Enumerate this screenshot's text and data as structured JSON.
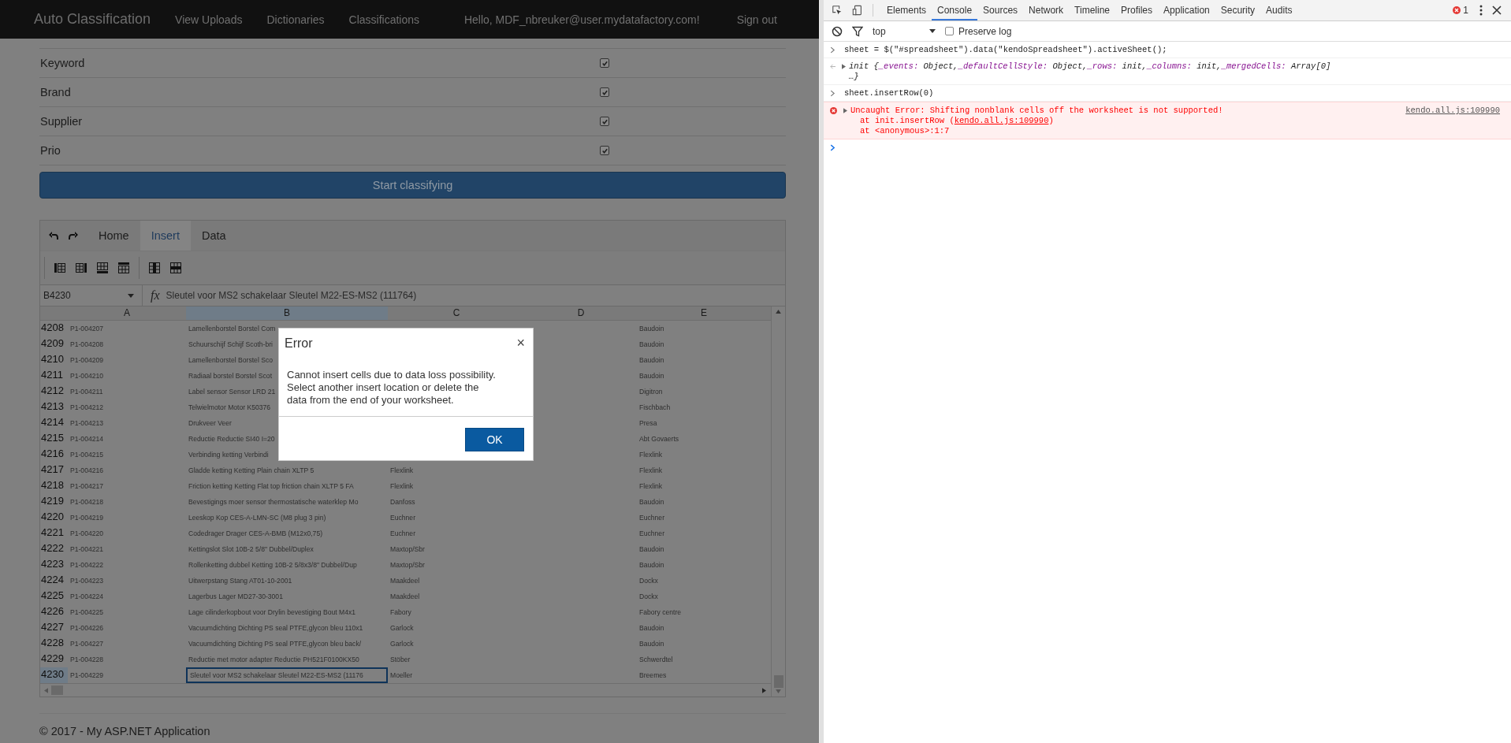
{
  "nav": {
    "brand": "Auto Classification",
    "links": [
      "View Uploads",
      "Dictionaries",
      "Classifications"
    ],
    "greeting": "Hello, MDF_nbreuker@user.mydatafactory.com!",
    "sign_out": "Sign out"
  },
  "options": [
    {
      "label": "Keyword",
      "checked": true
    },
    {
      "label": "Brand",
      "checked": true
    },
    {
      "label": "Supplier",
      "checked": true
    },
    {
      "label": "Prio",
      "checked": true
    }
  ],
  "start_button": "Start classifying",
  "spreadsheet": {
    "tabs": [
      {
        "label": "Home",
        "selected": false
      },
      {
        "label": "Insert",
        "selected": true
      },
      {
        "label": "Data",
        "selected": false
      }
    ],
    "name_box": "B4230",
    "fx_label": "fx",
    "formula": "Sleutel voor MS2 schakelaar Sleutel M22-ES-MS2 (111764)",
    "columns": [
      {
        "label": "A",
        "selected": false
      },
      {
        "label": "B",
        "selected": true
      },
      {
        "label": "C",
        "selected": false
      },
      {
        "label": "D",
        "selected": false
      },
      {
        "label": "E",
        "selected": false
      }
    ],
    "rows": [
      {
        "number": "4208",
        "selected": false,
        "a": "P1-004207",
        "b": "Lamellenborstel Borstel Com",
        "e": "Baudoin"
      },
      {
        "number": "4209",
        "selected": false,
        "a": "P1-004208",
        "b": "Schuurschijf Schijf Scoth-bri",
        "e": "Baudoin"
      },
      {
        "number": "4210",
        "selected": false,
        "a": "P1-004209",
        "b": "Lamellenborstel Borstel Sco",
        "e": "Baudoin"
      },
      {
        "number": "4211",
        "selected": false,
        "a": "P1-004210",
        "b": "Radiaal borstel Borstel Scot",
        "e": "Baudoin"
      },
      {
        "number": "4212",
        "selected": false,
        "a": "P1-004211",
        "b": "Label sensor Sensor LRD 21",
        "e": "Digitron"
      },
      {
        "number": "4213",
        "selected": false,
        "a": "P1-004212",
        "b": "Telwielmotor Motor K50376",
        "e": "Fischbach"
      },
      {
        "number": "4214",
        "selected": false,
        "a": "P1-004213",
        "b": "Drukveer Veer",
        "e": "Presa"
      },
      {
        "number": "4215",
        "selected": false,
        "a": "P1-004214",
        "b": "Reductie Reductie SI40 I=20",
        "e": "Abt Govaerts"
      },
      {
        "number": "4216",
        "selected": false,
        "a": "P1-004215",
        "b": "Verbinding ketting Verbindi",
        "e": "Flexlink"
      },
      {
        "number": "4217",
        "selected": false,
        "a": "P1-004216",
        "b": "Gladde ketting Ketting Plain chain XLTP 5",
        "c": "Flexlink",
        "e": "Flexlink"
      },
      {
        "number": "4218",
        "selected": false,
        "a": "P1-004217",
        "b": "Friction ketting Ketting Flat top friction chain XLTP 5 FA",
        "c": "Flexlink",
        "e": "Flexlink"
      },
      {
        "number": "4219",
        "selected": false,
        "a": "P1-004218",
        "b": "Bevestigings moer sensor thermostatische waterklep Mo",
        "c": "Danfoss",
        "e": "Baudoin"
      },
      {
        "number": "4220",
        "selected": false,
        "a": "P1-004219",
        "b": "Leeskop Kop CES-A-LMN-SC (M8 plug 3 pin)",
        "c": "Euchner",
        "e": "Euchner"
      },
      {
        "number": "4221",
        "selected": false,
        "a": "P1-004220",
        "b": "Codedrager Drager CES-A-BMB (M12x0,75)",
        "c": "Euchner",
        "e": "Euchner"
      },
      {
        "number": "4222",
        "selected": false,
        "a": "P1-004221",
        "b": "Kettingslot Slot 10B-2 5/8\" Dubbel/Duplex",
        "c": "Maxtop/Sbr",
        "e": "Baudoin"
      },
      {
        "number": "4223",
        "selected": false,
        "a": "P1-004222",
        "b": "Rollenketting dubbel Ketting 10B-2 5/8x3/8\" Dubbel/Dup",
        "c": "Maxtop/Sbr",
        "e": "Baudoin"
      },
      {
        "number": "4224",
        "selected": false,
        "a": "P1-004223",
        "b": "Uitwerpstang Stang AT01-10-2001",
        "c": "Maakdeel",
        "e": "Dockx"
      },
      {
        "number": "4225",
        "selected": false,
        "a": "P1-004224",
        "b": "Lagerbus Lager MD27-30-3001",
        "c": "Maakdeel",
        "e": "Dockx"
      },
      {
        "number": "4226",
        "selected": false,
        "a": "P1-004225",
        "b": "Lage cilinderkopbout voor Drylin bevestiging Bout M4x1",
        "c": "Fabory",
        "e": "Fabory centre"
      },
      {
        "number": "4227",
        "selected": false,
        "a": "P1-004226",
        "b": "Vacuumdichting Dichting PS seal PTFE,glycon bleu 110x1",
        "c": "Garlock",
        "e": "Baudoin"
      },
      {
        "number": "4228",
        "selected": false,
        "a": "P1-004227",
        "b": "Vacuumdichting Dichting PS seal PTFE,glycon bleu back/",
        "c": "Garlock",
        "e": "Baudoin"
      },
      {
        "number": "4229",
        "selected": false,
        "a": "P1-004228",
        "b": "Reductie met motor adapter Reductie PH521F0100KX50",
        "c": "Stöber",
        "e": "Schwerdtel"
      },
      {
        "number": "4230",
        "selected": true,
        "a": "P1-004229",
        "b": "Sleutel voor MS2 schakelaar Sleutel M22-ES-MS2 (11176",
        "c": "Moeller",
        "e": "Breemes"
      }
    ]
  },
  "dialog": {
    "title": "Error",
    "close": "×",
    "message": "Cannot insert cells due to data loss possibility. Select another insert location or delete the data from the end of your worksheet.",
    "ok": "OK"
  },
  "footer": "© 2017 - My ASP.NET Application",
  "devtools": {
    "tabs": [
      {
        "label": "Elements",
        "selected": false
      },
      {
        "label": "Console",
        "selected": true
      },
      {
        "label": "Sources",
        "selected": false
      },
      {
        "label": "Network",
        "selected": false
      },
      {
        "label": "Timeline",
        "selected": false
      },
      {
        "label": "Profiles",
        "selected": false
      },
      {
        "label": "Application",
        "selected": false
      },
      {
        "label": "Security",
        "selected": false
      },
      {
        "label": "Audits",
        "selected": false
      }
    ],
    "error_count": "1",
    "context": "top",
    "preserve_log": {
      "label": "Preserve log",
      "checked": false
    },
    "console": [
      {
        "kind": "input",
        "text": "sheet = $(\"#spreadsheet\").data(\"kendoSpreadsheet\").activeSheet();"
      },
      {
        "kind": "output",
        "head": "init {",
        "props": [
          {
            "key": "_events:",
            "value": "Object,"
          },
          {
            "key": "_defaultCellStyle:",
            "value": "Object,"
          },
          {
            "key": "_rows:",
            "value": "init,"
          },
          {
            "key": "_columns:",
            "value": "init,"
          },
          {
            "key": "_mergedCells:",
            "value": "Array[0]"
          }
        ],
        "tail": "…}"
      },
      {
        "kind": "input",
        "text": "sheet.insertRow(0)"
      },
      {
        "kind": "error",
        "text": "Uncaught Error: Shifting nonblank cells off the worksheet is not supported!",
        "source": "kendo.all.js:109990",
        "stack": [
          {
            "before": "at init.insertRow (",
            "link": "kendo.all.js:109990",
            "after": ")"
          },
          {
            "before": "at <anonymous>:1:7"
          }
        ]
      },
      {
        "kind": "prompt"
      }
    ]
  }
}
